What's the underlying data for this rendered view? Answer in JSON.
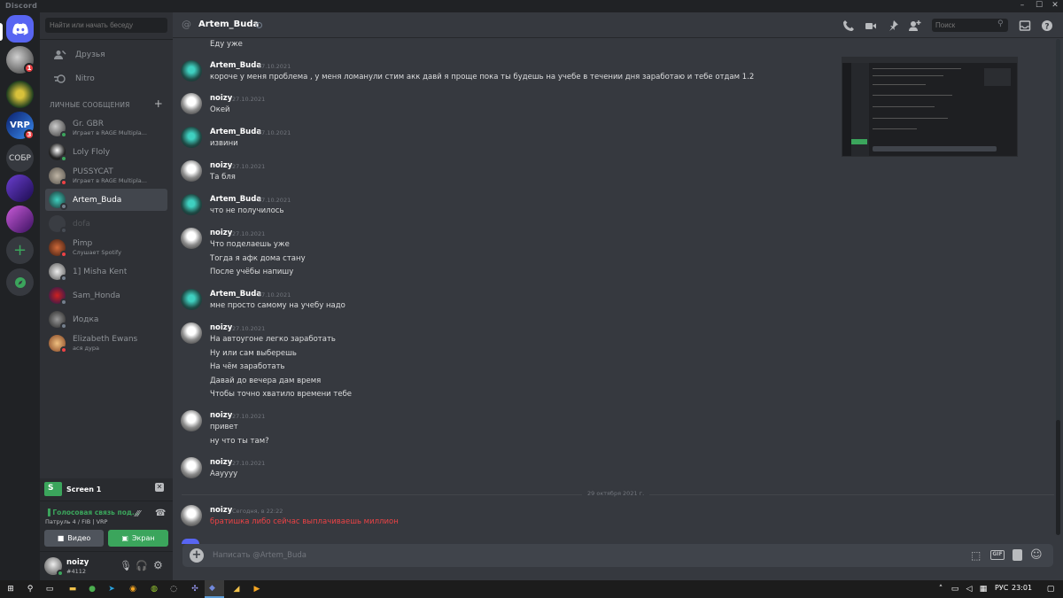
{
  "window": {
    "app_name": "Discord"
  },
  "guilds": [
    {
      "label": "",
      "badge": "1"
    },
    {
      "label": "",
      "badge": ""
    },
    {
      "label": "",
      "badge": "3"
    },
    {
      "label": "СОБР",
      "badge": ""
    },
    {
      "label": "",
      "badge": ""
    },
    {
      "label": "",
      "badge": ""
    }
  ],
  "sidebar": {
    "search_placeholder": "Найти или начать беседу",
    "friends_label": "Друзья",
    "nitro_label": "Nitro",
    "dm_header": "ЛИЧНЫЕ СООБЩЕНИЯ",
    "dms": [
      {
        "name": "Gr. GBR",
        "sub": "Играет в RAGE Multipla...",
        "status": "online"
      },
      {
        "name": "Loly Floly",
        "sub": "",
        "status": "online"
      },
      {
        "name": "PUSSYCAT",
        "sub": "Играет в RAGE Multipla...",
        "status": "dnd"
      },
      {
        "name": "Artem_Buda",
        "sub": "",
        "status": "offline"
      },
      {
        "name": "dofa",
        "sub": "",
        "status": "offline"
      },
      {
        "name": "Pimp",
        "sub": "Слушает Spotify",
        "status": "dnd"
      },
      {
        "name": "1] Misha Kent",
        "sub": "",
        "status": "offline"
      },
      {
        "name": "Sam_Honda",
        "sub": "",
        "status": "offline"
      },
      {
        "name": "Йодка",
        "sub": "",
        "status": "offline"
      },
      {
        "name": "Elizabeth Ewans",
        "sub": "ася дура",
        "status": "dnd"
      }
    ]
  },
  "screen_panel": {
    "title": "Screen 1",
    "voice_status": "Голосовая связь под...",
    "voice_channel": "Патруль 4 / FIB | VRP",
    "video_label": "Видео",
    "screen_label": "Экран"
  },
  "user": {
    "name": "noizy",
    "tag": "#4112"
  },
  "chat": {
    "channel_name": "Artem_Buda",
    "search_placeholder": "Поиск",
    "first_line": "Еду уже",
    "messages": [
      {
        "author": "Artem_Buda",
        "time": "27.10.2021",
        "lines": [
          "короче у меня проблема ,  у меня ломанули стим акк давй я проще пока ты будешь на учебе в течении дня заработаю и тебе отдам 1.2"
        ]
      },
      {
        "author": "noizy",
        "time": "27.10.2021",
        "lines": [
          "Окей"
        ]
      },
      {
        "author": "Artem_Buda",
        "time": "27.10.2021",
        "lines": [
          "извини"
        ]
      },
      {
        "author": "noizy",
        "time": "27.10.2021",
        "lines": [
          "Та бля"
        ]
      },
      {
        "author": "Artem_Buda",
        "time": "27.10.2021",
        "lines": [
          "что не получилось"
        ]
      },
      {
        "author": "noizy",
        "time": "27.10.2021",
        "lines": [
          "Что поделаешь уже",
          "Тогда я афк дома стану",
          "После учёбы напишу"
        ]
      },
      {
        "author": "Artem_Buda",
        "time": "27.10.2021",
        "lines": [
          "мне просто самому на учебу надо"
        ]
      },
      {
        "author": "noizy",
        "time": "27.10.2021",
        "lines": [
          "На автоугоне легко заработать",
          "Ну или сам выберешь",
          "На чём заработать",
          "Давай до вечера дам время",
          "Чтобы точно хватило времени тебе"
        ]
      },
      {
        "author": "noizy",
        "time": "27.10.2021",
        "lines": [
          "привет",
          "ну что ты там?"
        ]
      },
      {
        "author": "noizy",
        "time": "27.10.2021",
        "lines": [
          "Аауууу"
        ]
      },
      {
        "author": "noizy",
        "time": "Сегодня, в 22:22",
        "lines": [
          "братишка либо сейчас выплачиваешь миллион"
        ]
      }
    ],
    "divider_text": "29 октября 2021 г.",
    "composer_placeholder": "Написать @Artem_Buda"
  },
  "taskbar": {
    "language": "РУС",
    "time": "23:01"
  },
  "colors": {
    "accent": "#5865f2",
    "online": "#3ba55c",
    "dnd": "#ed4245",
    "offline": "#747f8d",
    "screen_button": "#3ba55c"
  }
}
